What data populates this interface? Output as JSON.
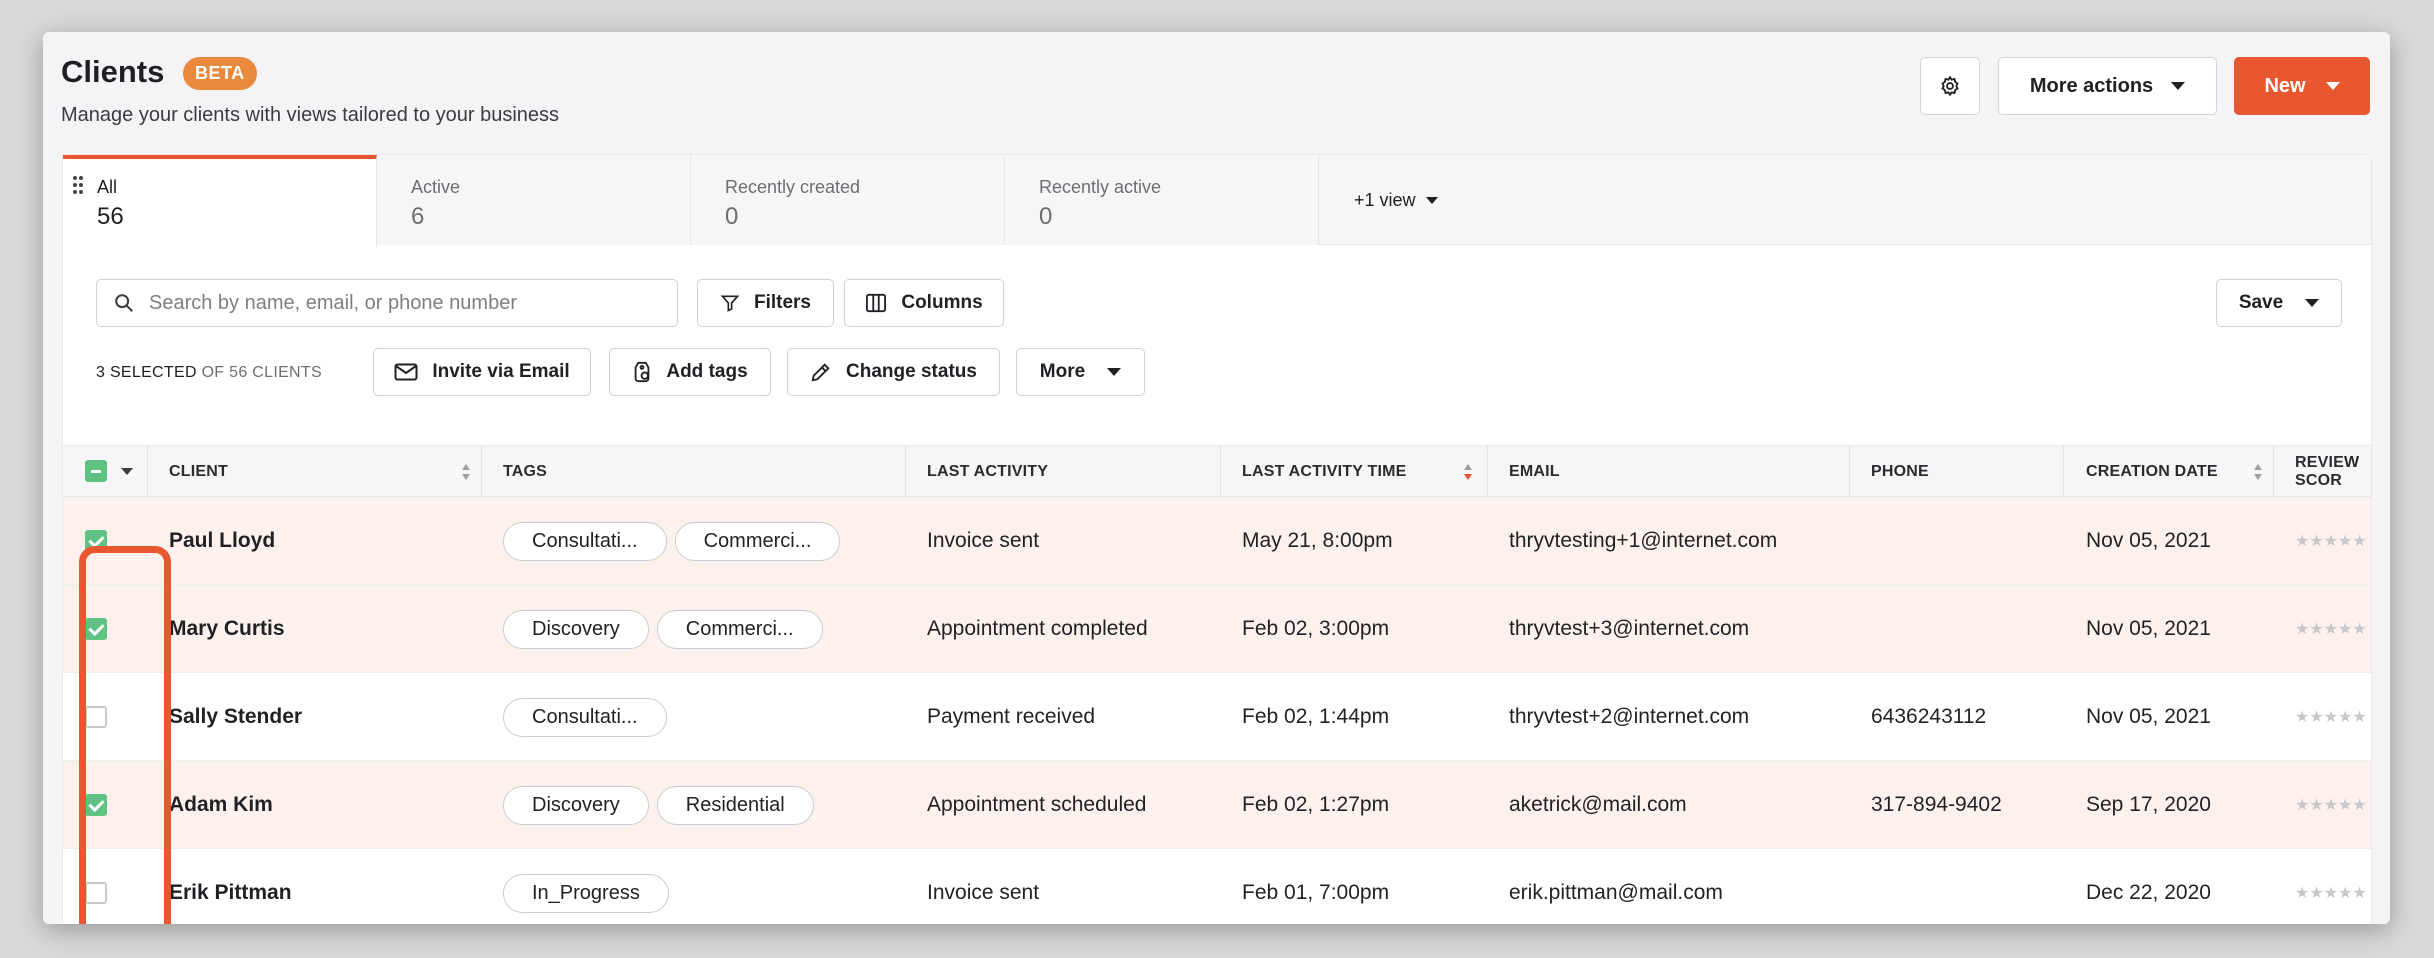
{
  "header": {
    "title": "Clients",
    "badge": "BETA",
    "subtitle": "Manage your clients with views tailored to your business",
    "more_actions_label": "More actions",
    "new_label": "New"
  },
  "tabs": [
    {
      "label": "All",
      "count": "56"
    },
    {
      "label": "Active",
      "count": "6"
    },
    {
      "label": "Recently created",
      "count": "0"
    },
    {
      "label": "Recently active",
      "count": "0"
    }
  ],
  "extra_views_label": "+1 view",
  "toolbar": {
    "search_placeholder": "Search by name, email, or phone number",
    "filters_label": "Filters",
    "columns_label": "Columns",
    "save_label": "Save"
  },
  "selection": {
    "selected_text": "3 SELECTED",
    "of_text": "OF 56 CLIENTS",
    "invite_label": "Invite via Email",
    "add_tags_label": "Add tags",
    "change_status_label": "Change status",
    "more_label": "More"
  },
  "columns": {
    "client": "CLIENT",
    "tags": "TAGS",
    "last_activity": "LAST ACTIVITY",
    "last_activity_time": "LAST ACTIVITY TIME",
    "email": "EMAIL",
    "phone": "PHONE",
    "creation_date": "CREATION DATE",
    "review_score": "REVIEW SCOR"
  },
  "rows": [
    {
      "name": "Paul Lloyd",
      "tags": [
        "Consultati...",
        "Commerci..."
      ],
      "last_activity": "Invoice sent",
      "time": "May 21, 8:00pm",
      "email": "thryvtesting+1@internet.com",
      "phone": "",
      "created": "Nov 05, 2021",
      "stars": "★★★★★"
    },
    {
      "name": "Mary Curtis",
      "tags": [
        "Discovery",
        "Commerci..."
      ],
      "last_activity": "Appointment completed",
      "time": "Feb 02, 3:00pm",
      "email": "thryvtest+3@internet.com",
      "phone": "",
      "created": "Nov 05, 2021",
      "stars": "★★★★★"
    },
    {
      "name": "Sally Stender",
      "tags": [
        "Consultati..."
      ],
      "last_activity": "Payment received",
      "time": "Feb 02, 1:44pm",
      "email": "thryvtest+2@internet.com",
      "phone": "6436243112",
      "created": "Nov 05, 2021",
      "stars": "★★★★★"
    },
    {
      "name": "Adam Kim",
      "tags": [
        "Discovery",
        "Residential"
      ],
      "last_activity": "Appointment scheduled",
      "time": "Feb 02, 1:27pm",
      "email": "aketrick@mail.com",
      "phone": "317-894-9402",
      "created": "Sep 17, 2020",
      "stars": "★★★★★"
    },
    {
      "name": "Erik Pittman",
      "tags": [
        "In_Progress"
      ],
      "last_activity": "Invoice sent",
      "time": "Feb 01, 7:00pm",
      "email": "erik.pittman@mail.com",
      "phone": "",
      "created": "Dec 22, 2020",
      "stars": "★★★★★"
    }
  ],
  "row_selected": [
    true,
    true,
    false,
    true,
    false
  ],
  "colors": {
    "accent": "#e8572f",
    "checkbox": "#5fc283",
    "badge": "#e98a3c"
  },
  "icons": [
    "gear-icon",
    "chevron-down-icon",
    "drag-handle-icon",
    "search-icon",
    "filter-icon",
    "columns-icon",
    "envelope-icon",
    "tag-icon",
    "pencil-icon",
    "sort-icon"
  ]
}
